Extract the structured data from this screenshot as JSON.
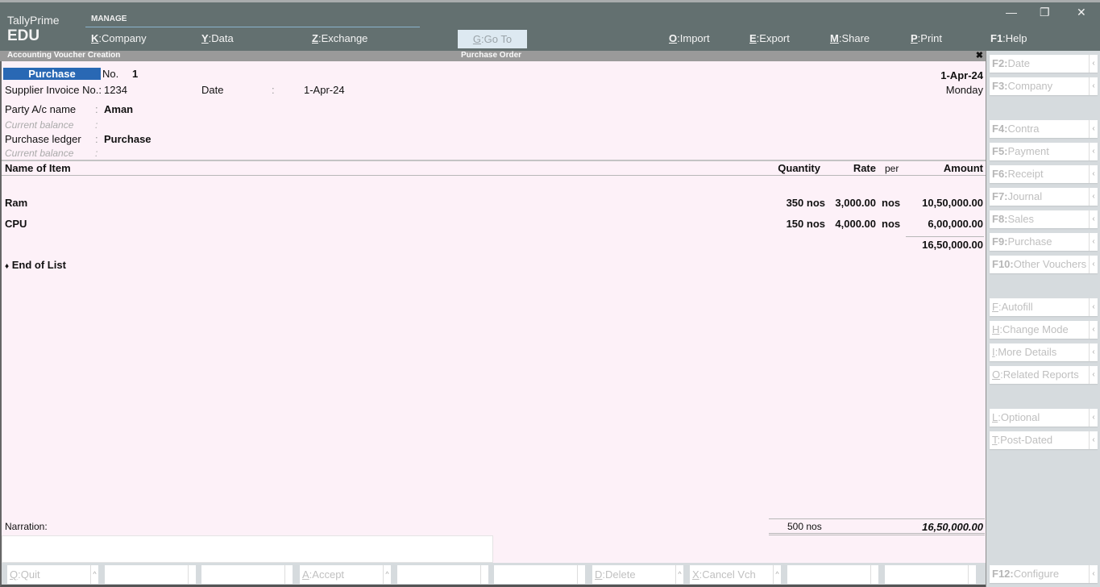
{
  "app": {
    "name": "TallyPrime",
    "edition": "EDU"
  },
  "topmenu": {
    "section_label": "MANAGE",
    "items": [
      {
        "key": "K",
        "label": "Company"
      },
      {
        "key": "Y",
        "label": "Data"
      },
      {
        "key": "Z",
        "label": "Exchange"
      }
    ],
    "goto": {
      "key": "G",
      "label": "Go To"
    },
    "right_items": [
      {
        "key": "O",
        "label": "Import"
      },
      {
        "key": "E",
        "label": "Export"
      },
      {
        "key": "M",
        "label": "Share"
      },
      {
        "key": "P",
        "label": "Print"
      },
      {
        "key": "F1",
        "label": "Help"
      }
    ]
  },
  "window_controls": {
    "minimize": "—",
    "restore": "❐",
    "close": "✕"
  },
  "titlebar": {
    "left": "Accounting Voucher Creation",
    "center": "Purchase Order",
    "close": "✖"
  },
  "voucher": {
    "type": "Purchase",
    "no_label": "No.",
    "no_value": "1",
    "date": "1-Apr-24",
    "day": "Monday",
    "supplier_invoice_label": "Supplier Invoice No.:",
    "supplier_invoice_value": "1234",
    "inv_date_label": "Date",
    "colon": ":",
    "inv_date_value": "1-Apr-24",
    "party_label": "Party A/c name",
    "party_value": "Aman",
    "current_balance_label": "Current balance",
    "purchase_ledger_label": "Purchase ledger",
    "purchase_ledger_value": "Purchase"
  },
  "table": {
    "headers": {
      "name": "Name of Item",
      "quantity": "Quantity",
      "rate": "Rate",
      "per": "per",
      "amount": "Amount"
    },
    "rows": [
      {
        "name": "Ram",
        "quantity": "350 nos",
        "rate": "3,000.00",
        "per": "nos",
        "amount": "10,50,000.00"
      },
      {
        "name": "CPU",
        "quantity": "150 nos",
        "rate": "4,000.00",
        "per": "nos",
        "amount": "6,00,000.00"
      }
    ],
    "subtotal": "16,50,000.00",
    "end_marker": "♦",
    "end_label": "End of List"
  },
  "footer": {
    "narration_label": "Narration:",
    "narration_value": "",
    "total_quantity": "500 nos",
    "total_amount": "16,50,000.00"
  },
  "side_buttons": [
    {
      "key": "F2",
      "label": "Date"
    },
    {
      "key": "F3",
      "label": "Company"
    },
    {
      "key": "F4",
      "label": "Contra"
    },
    {
      "key": "F5",
      "label": "Payment"
    },
    {
      "key": "F6",
      "label": "Receipt"
    },
    {
      "key": "F7",
      "label": "Journal"
    },
    {
      "key": "F8",
      "label": "Sales"
    },
    {
      "key": "F9",
      "label": "Purchase"
    },
    {
      "key": "F10",
      "label": "Other Vouchers"
    },
    {
      "key": "F",
      "label": "Autofill"
    },
    {
      "key": "H",
      "label": "Change Mode"
    },
    {
      "key": "I",
      "label": "More Details"
    },
    {
      "key": "O",
      "label": "Related Reports"
    },
    {
      "key": "L",
      "label": "Optional"
    },
    {
      "key": "T",
      "label": "Post-Dated"
    },
    {
      "key": "F12",
      "label": "Configure"
    }
  ],
  "bottom_buttons": [
    {
      "key": "Q",
      "label": "Quit"
    },
    {
      "key": "",
      "label": ""
    },
    {
      "key": "",
      "label": ""
    },
    {
      "key": "A",
      "label": "Accept"
    },
    {
      "key": "",
      "label": ""
    },
    {
      "key": "",
      "label": ""
    },
    {
      "key": "D",
      "label": "Delete"
    },
    {
      "key": "X",
      "label": "Cancel Vch"
    },
    {
      "key": "",
      "label": ""
    },
    {
      "key": "",
      "label": ""
    }
  ],
  "glyphs": {
    "chevron_left": "‹",
    "caret_up": "^",
    "key_sep": ":"
  }
}
